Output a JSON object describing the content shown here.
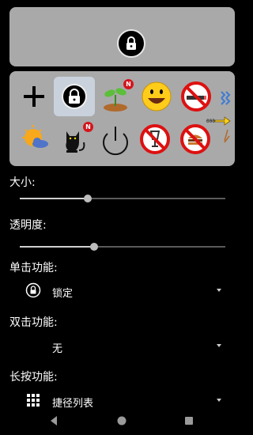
{
  "preview": {
    "icon": "lock-icon"
  },
  "shortcuts": [
    {
      "icon": "plus-icon"
    },
    {
      "icon": "lock-icon",
      "selected": true
    },
    {
      "icon": "sprout-icon",
      "badge": "N"
    },
    {
      "icon": "smiley-face-icon"
    },
    {
      "icon": "no-smoking-icon"
    },
    {
      "icon": "blue-arrows-icon"
    },
    {
      "icon": "sun-cloud-icon"
    },
    {
      "icon": "black-cat-icon",
      "badge": "N"
    },
    {
      "icon": "power-icon"
    },
    {
      "icon": "no-drinking-icon"
    },
    {
      "icon": "no-food-icon"
    },
    {
      "icon": "key-arrow-icon",
      "text": "000"
    }
  ],
  "size": {
    "label": "大小:",
    "value": 0.33
  },
  "transparency": {
    "label": "透明度:",
    "value": 0.36
  },
  "single_click": {
    "label": "单击功能:",
    "value": "锁定",
    "icon": "lock-icon"
  },
  "double_click": {
    "label": "双击功能:",
    "value": "无"
  },
  "long_press": {
    "label": "长按功能:",
    "value": "捷径列表",
    "icon": "grid-icon"
  },
  "navbar": {
    "back": "back-icon",
    "home": "home-icon",
    "recents": "recents-icon"
  }
}
